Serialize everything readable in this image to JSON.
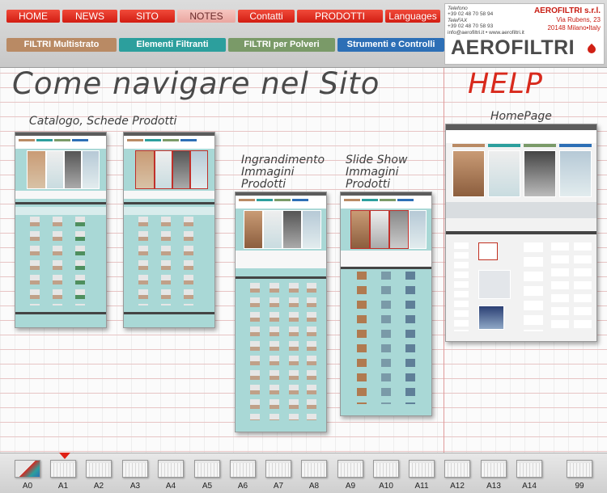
{
  "nav": {
    "items": [
      {
        "label": "HOME",
        "w": 66
      },
      {
        "label": "NEWS",
        "w": 68
      },
      {
        "label": "SITO",
        "w": 68
      },
      {
        "label": "NOTES",
        "w": 72,
        "active": true
      },
      {
        "label": "Contatti",
        "w": 70
      },
      {
        "label": "PRODOTTI",
        "w": 106
      },
      {
        "label": "Languages",
        "w": 68
      }
    ]
  },
  "categories": [
    {
      "label": "FILTRI Multistrato",
      "color": "#b98a64"
    },
    {
      "label": "Elementi Filtranti",
      "color": "#2c9f9d"
    },
    {
      "label": "FILTRI per Polveri",
      "color": "#7a9a68"
    },
    {
      "label": "Strumenti e Controlli",
      "color": "#2d6fb6"
    }
  ],
  "company": {
    "phone_label": "Telefono",
    "phone": "+39 02 48 70 58 94",
    "fax_label": "TeleFAX",
    "fax": "+39 02 48 70 58 93",
    "web": "info@aerofiltri.it • www.aerofiltri.it",
    "name": "AEROFILTRI s.r.l.",
    "address": "Via Rubens, 23",
    "city": "20148 Milano•Italy",
    "logo": "AEROFILTRI"
  },
  "page_title": "Come navigare nel Sito",
  "help_title": "HELP",
  "sections": {
    "catalogo": "Catalogo, Schede Prodotti",
    "ingrandimento": [
      "Ingrandimento",
      "Immagini",
      "Prodotti"
    ],
    "slideshow": [
      "Slide Show",
      "Immagini",
      "Prodotti"
    ],
    "homepage": "HomePage"
  },
  "thumbnails": [
    {
      "label": "A0"
    },
    {
      "label": "A1",
      "selected": true
    },
    {
      "label": "A2"
    },
    {
      "label": "A3"
    },
    {
      "label": "A4"
    },
    {
      "label": "A5"
    },
    {
      "label": "A6"
    },
    {
      "label": "A7"
    },
    {
      "label": "A8"
    },
    {
      "label": "A9"
    },
    {
      "label": "A10"
    },
    {
      "label": "A11"
    },
    {
      "label": "A12"
    },
    {
      "label": "A13"
    },
    {
      "label": "A14"
    },
    {
      "label": "99"
    }
  ]
}
